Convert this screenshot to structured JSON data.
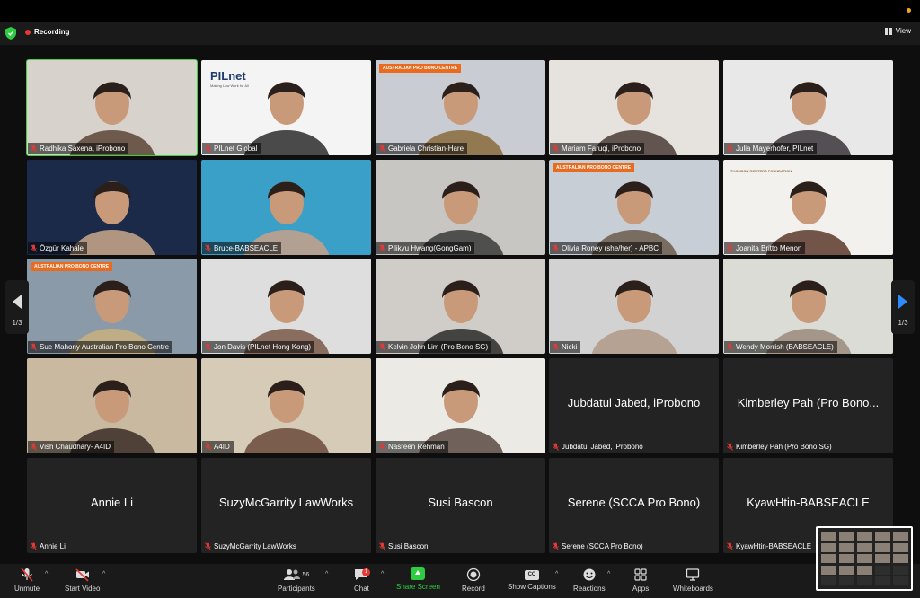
{
  "app": {
    "recording_label": "Recording",
    "view_label": "View"
  },
  "colors": {
    "active_speaker": "#3fd23f",
    "recording": "#e53935",
    "share_screen": "#2ecc40",
    "page_arrow_right": "#2e8bff"
  },
  "pagination": {
    "left": "1/3",
    "right": "1/3"
  },
  "logos": {
    "apbc": "AUSTRALIAN PRO BONO CENTRE",
    "pilnet": "PILnet",
    "pilnet_tagline": "Making Law Work for All",
    "trf": "THOMSON REUTERS FOUNDATION"
  },
  "participants": [
    {
      "name": "Radhika Saxena, iProbono",
      "video": true,
      "active": true
    },
    {
      "name": "PILnet Global",
      "video": true
    },
    {
      "name": "Gabriela Christian-Hare",
      "video": true
    },
    {
      "name": "Mariam Faruqi, iProbono",
      "video": true
    },
    {
      "name": "Julia Mayerhofer, PILnet",
      "video": true
    },
    {
      "name": "Özgür Kahale",
      "video": true
    },
    {
      "name": "Bruce-BABSEACLE",
      "video": true
    },
    {
      "name": "Pilikyu Hwang(GongGam)",
      "video": true
    },
    {
      "name": "Olivia Roney (she/her) - APBC",
      "video": true
    },
    {
      "name": "Joanita Britto Menon",
      "video": true
    },
    {
      "name": "Sue Mahony Australian Pro Bono Centre",
      "video": true
    },
    {
      "name": "Jon Davis (PILnet Hong Kong)",
      "video": true
    },
    {
      "name": "Kelvin John Lim (Pro Bono SG)",
      "video": true
    },
    {
      "name": "Nicki",
      "video": true
    },
    {
      "name": "Wendy Morrish (BABSEACLE)",
      "video": true
    },
    {
      "name": "Vish Chaudhary- A4ID",
      "video": true
    },
    {
      "name": "A4ID",
      "video": true
    },
    {
      "name": "Nasreen Rehman",
      "video": true
    },
    {
      "name": "Jubdatul Jabed, iProbono",
      "video": false,
      "display": "Jubdatul Jabed, iProbono"
    },
    {
      "name": "Kimberley Pah (Pro Bono SG)",
      "video": false,
      "display": "Kimberley Pah (Pro Bono..."
    },
    {
      "name": "Annie Li",
      "video": false,
      "display": "Annie Li"
    },
    {
      "name": "SuzyMcGarrity LawWorks",
      "video": false,
      "display": "SuzyMcGarrity LawWorks"
    },
    {
      "name": "Susi Bascon",
      "video": false,
      "display": "Susi Bascon"
    },
    {
      "name": "Serene (SCCA Pro Bono)",
      "video": false,
      "display": "Serene (SCCA Pro Bono)"
    },
    {
      "name": "KyawHtin-BABSEACLE",
      "video": false,
      "display": "KyawHtin-BABSEACLE"
    }
  ],
  "toolbar": {
    "unmute": "Unmute",
    "start_video": "Start Video",
    "participants": "Participants",
    "participants_count": "56",
    "chat": "Chat",
    "chat_badge": "1",
    "share_screen": "Share Screen",
    "record": "Record",
    "show_captions": "Show Captions",
    "cc": "CC",
    "reactions": "Reactions",
    "apps": "Apps",
    "whiteboards": "Whiteboards"
  }
}
